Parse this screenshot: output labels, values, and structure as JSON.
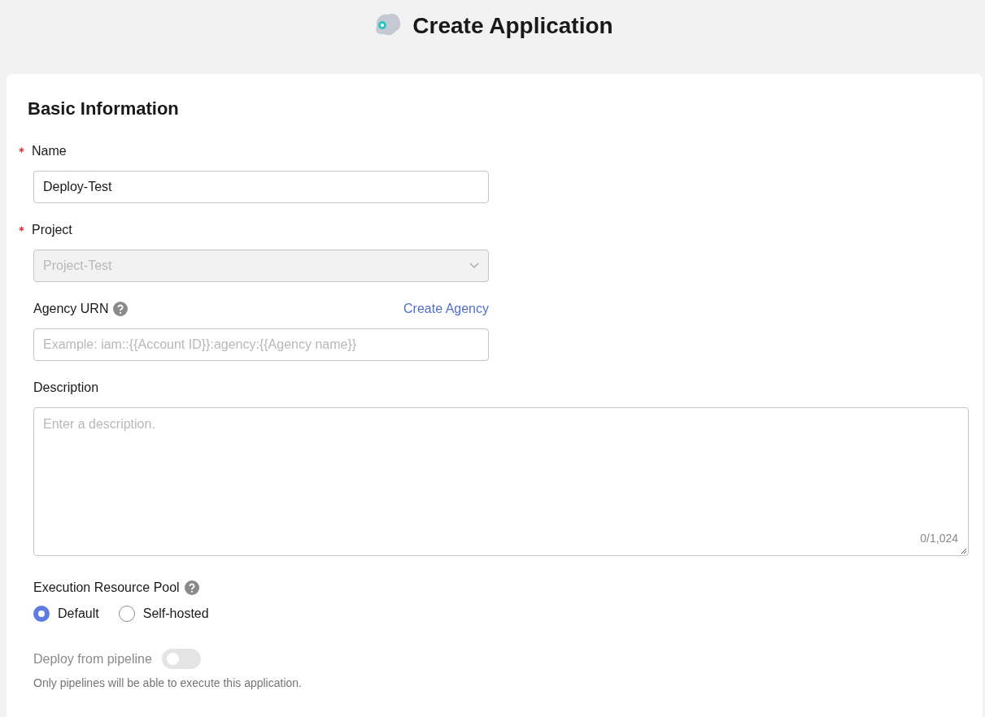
{
  "page_title": "Create Application",
  "section_title": "Basic Information",
  "name_field": {
    "label": "Name",
    "required": true,
    "value": "Deploy-Test"
  },
  "project_field": {
    "label": "Project",
    "required": true,
    "value": "Project-Test",
    "disabled": true
  },
  "agency_field": {
    "label": "Agency URN",
    "link": "Create Agency",
    "placeholder": "Example: iam::{{Account ID}}:agency:{{Agency name}}"
  },
  "description_field": {
    "label": "Description",
    "placeholder": "Enter a description.",
    "counter": "0/1,024"
  },
  "resource_pool": {
    "label": "Execution Resource Pool",
    "options": [
      {
        "label": "Default",
        "selected": true
      },
      {
        "label": "Self-hosted",
        "selected": false
      }
    ]
  },
  "pipeline_toggle": {
    "label": "Deploy from pipeline",
    "on": false,
    "disabled": true,
    "hint": "Only pipelines will be able to execute this application."
  }
}
